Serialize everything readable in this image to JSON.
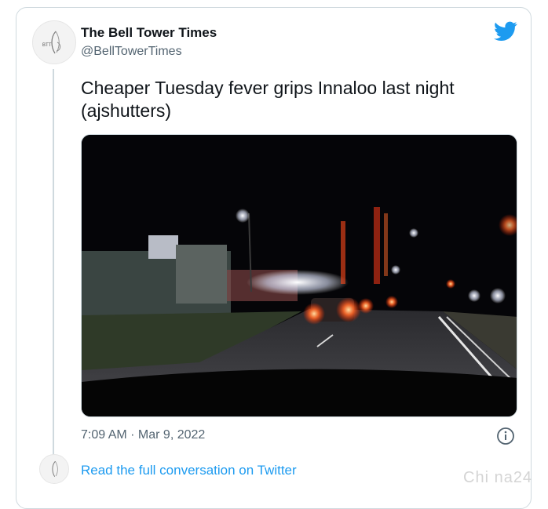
{
  "tweet": {
    "author_name": "The Bell Tower Times",
    "author_handle": "@BellTowerTimes",
    "avatar_label": "BTT",
    "text": "Cheaper Tuesday fever grips Innaloo last night (ajshutters)",
    "timestamp": "7:09 AM · Mar 9, 2022",
    "read_more": "Read the full conversation on Twitter"
  },
  "icons": {
    "brand": "twitter-bird-icon",
    "info": "info-icon"
  },
  "colors": {
    "twitter_blue": "#1d9bf0",
    "text_primary": "#0f1419",
    "text_secondary": "#536471",
    "border": "#cfd9de"
  },
  "watermark": "Chi na24"
}
